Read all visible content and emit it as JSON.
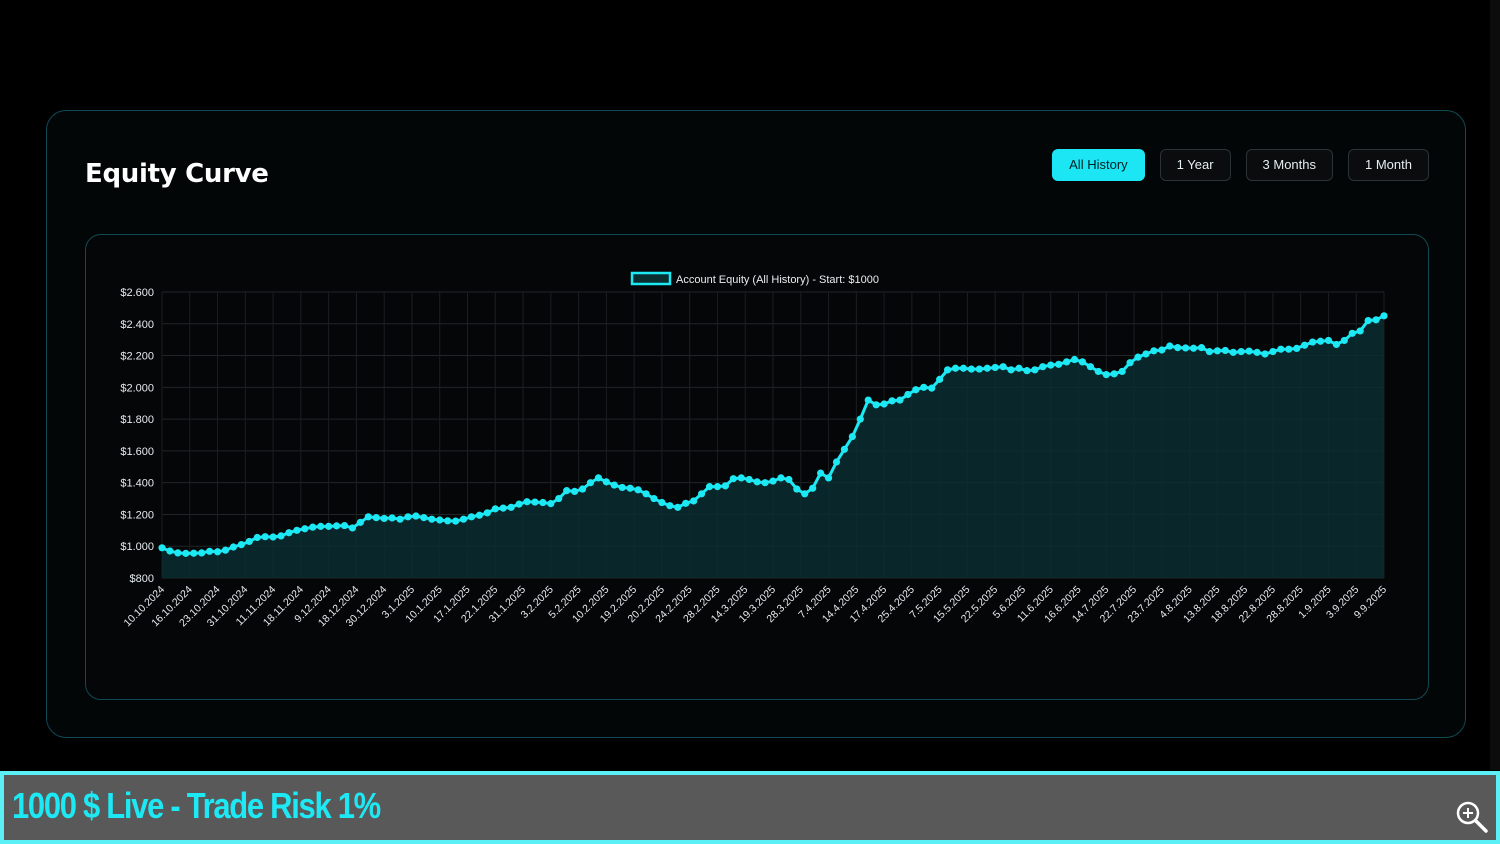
{
  "card": {
    "title": "Equity Curve"
  },
  "tabs": [
    {
      "label": "All History",
      "active": true
    },
    {
      "label": "1 Year",
      "active": false
    },
    {
      "label": "3 Months",
      "active": false
    },
    {
      "label": "1 Month",
      "active": false
    }
  ],
  "footer": {
    "text": "1000 $ Live - Trade Risk 1%",
    "icon": "zoom-in-icon"
  },
  "colors": {
    "accent": "#1ce6f4",
    "line": "#1de9f5",
    "fill": "#0b2e30",
    "footer_bg": "#595959",
    "footer_border": "#5af0f5"
  },
  "chart_data": {
    "type": "line",
    "legend": "Account Equity (All History) - Start: $1000",
    "legend_position": "top",
    "grid": true,
    "ylim": [
      800,
      2600
    ],
    "y_ticks": [
      "$800",
      "$1.000",
      "$1.200",
      "$1.400",
      "$1.600",
      "$1.800",
      "$2.000",
      "$2.200",
      "$2.400",
      "$2.600"
    ],
    "x_labels": [
      "10.10.2024",
      "16.10.2024",
      "23.10.2024",
      "31.10.2024",
      "11.11.2024",
      "18.11.2024",
      "9.12.2024",
      "18.12.2024",
      "30.12.2024",
      "3.1.2025",
      "10.1.2025",
      "17.1.2025",
      "22.1.2025",
      "31.1.2025",
      "3.2.2025",
      "5.2.2025",
      "10.2.2025",
      "19.2.2025",
      "20.2.2025",
      "24.2.2025",
      "28.2.2025",
      "14.3.2025",
      "19.3.2025",
      "28.3.2025",
      "7.4.2025",
      "14.4.2025",
      "17.4.2025",
      "25.4.2025",
      "7.5.2025",
      "15.5.2025",
      "22.5.2025",
      "5.6.2025",
      "11.6.2025",
      "16.6.2025",
      "14.7.2025",
      "22.7.2025",
      "23.7.2025",
      "4.8.2025",
      "13.8.2025",
      "18.8.2025",
      "22.8.2025",
      "28.8.2025",
      "1.9.2025",
      "3.9.2025",
      "9.9.2025"
    ],
    "series": [
      {
        "name": "Account Equity (All History) - Start: $1000",
        "values": [
          990,
          970,
          958,
          955,
          956,
          958,
          968,
          965,
          975,
          995,
          1010,
          1030,
          1055,
          1060,
          1058,
          1065,
          1085,
          1100,
          1110,
          1120,
          1125,
          1125,
          1128,
          1130,
          1115,
          1150,
          1185,
          1180,
          1175,
          1178,
          1170,
          1185,
          1190,
          1180,
          1170,
          1165,
          1160,
          1158,
          1170,
          1185,
          1195,
          1210,
          1235,
          1240,
          1245,
          1265,
          1280,
          1278,
          1275,
          1268,
          1300,
          1350,
          1345,
          1360,
          1400,
          1430,
          1405,
          1385,
          1370,
          1365,
          1355,
          1330,
          1300,
          1275,
          1255,
          1245,
          1270,
          1285,
          1330,
          1375,
          1375,
          1380,
          1425,
          1430,
          1420,
          1405,
          1400,
          1410,
          1430,
          1420,
          1360,
          1330,
          1365,
          1460,
          1430,
          1530,
          1610,
          1690,
          1800,
          1920,
          1890,
          1895,
          1915,
          1920,
          1955,
          1985,
          2000,
          1995,
          2050,
          2110,
          2120,
          2120,
          2115,
          2115,
          2120,
          2125,
          2130,
          2110,
          2120,
          2105,
          2110,
          2130,
          2140,
          2145,
          2160,
          2175,
          2160,
          2130,
          2100,
          2080,
          2085,
          2100,
          2155,
          2190,
          2210,
          2230,
          2235,
          2260,
          2250,
          2248,
          2246,
          2250,
          2225,
          2230,
          2232,
          2220,
          2225,
          2228,
          2220,
          2210,
          2225,
          2240,
          2240,
          2245,
          2265,
          2285,
          2290,
          2295,
          2270,
          2295,
          2340,
          2355,
          2420,
          2425,
          2450
        ]
      }
    ]
  }
}
